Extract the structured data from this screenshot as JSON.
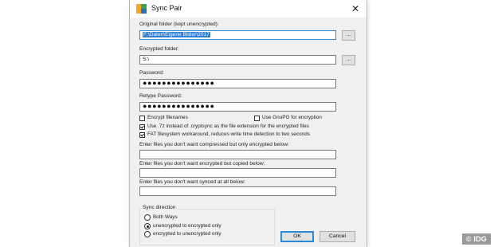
{
  "window": {
    "title": "Sync Pair",
    "close_glyph": "✕",
    "app_icon": "app-logo-icon"
  },
  "fields": {
    "original_label": "Original folder (kept unencrypted):",
    "original_value": "F:\\Daten\\Eigene Bilder\\2017",
    "encrypted_label": "Encrypted folder:",
    "encrypted_value": "S:\\",
    "password_label": "Password:",
    "password_value": "●●●●●●●●●●●●●●●",
    "retype_label": "Retype Password:",
    "retype_value": "●●●●●●●●●●●●●●●",
    "browse_label": "..."
  },
  "options": {
    "encrypt_filenames": {
      "label": "Encrypt filenames",
      "checked": false
    },
    "use_gnupg": {
      "label": "Use GnuPG for encryption",
      "checked": false
    },
    "use_7z": {
      "label": "Use .7z instead of .cryptsync as the file extension for the encrypted files",
      "checked": true
    },
    "fat_workaround": {
      "label": "FAT filesystem workaround, reduces write time detection to two seconds",
      "checked": true
    }
  },
  "filters": {
    "compressed_only_label": "Enter files you don't want compressed but only encrypted below:",
    "compressed_only_value": "",
    "copied_label": "Enter files you don't want encrypted but copied below:",
    "copied_value": "",
    "not_synced_label": "Enter files you don't want synced at all below:",
    "not_synced_value": ""
  },
  "sync_direction": {
    "title": "Sync direction",
    "options": [
      {
        "label": "Both Ways",
        "selected": false
      },
      {
        "label": "unencrypted to encrypted only",
        "selected": true
      },
      {
        "label": "encrypted to unencrypted only",
        "selected": false
      }
    ]
  },
  "buttons": {
    "ok": "OK",
    "cancel": "Cancel"
  },
  "credit": "© IDG",
  "colors": {
    "accent": "#2b8ad8",
    "selection": "#2e7fd6",
    "dialog_bg": "#f0f0f0"
  }
}
